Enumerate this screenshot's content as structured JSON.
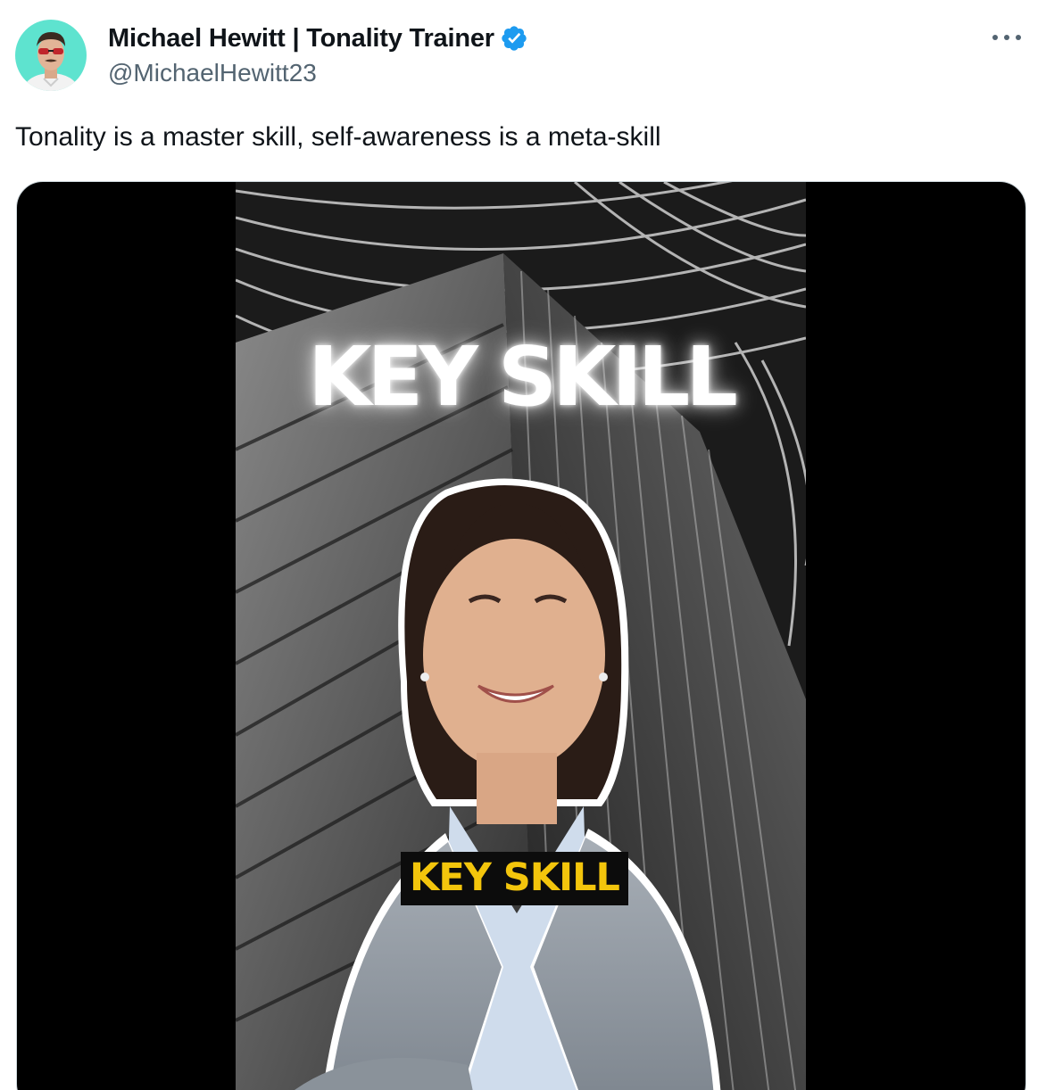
{
  "author": {
    "display_name": "Michael Hewitt | Tonality Trainer",
    "handle": "@MichaelHewitt23",
    "verified": true,
    "avatar_icon": "profile-avatar",
    "verified_icon": "verified-badge-icon"
  },
  "more_icon": "more-horizontal-icon",
  "tweet": {
    "text": "Tonality is a master skill, self-awareness is a meta-skill"
  },
  "media": {
    "type": "video",
    "caption_large": "KEY SKILL",
    "caption_small": "KEY SKILL"
  },
  "colors": {
    "verified_blue": "#1d9bf0",
    "text_primary": "#0f1419",
    "text_secondary": "#536471",
    "caption_yellow": "#f3c50c",
    "card_border": "#cfd9de"
  }
}
